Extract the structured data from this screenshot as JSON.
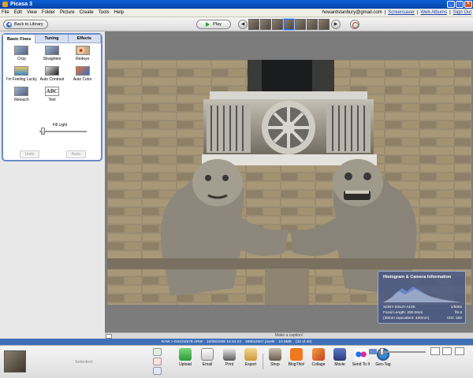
{
  "window": {
    "title": "Picasa 3"
  },
  "menu": [
    "File",
    "Edit",
    "View",
    "Folder",
    "Picture",
    "Create",
    "Tools",
    "Help"
  ],
  "account": {
    "email": "howardstanbury@gmail.com",
    "links": [
      "Screensaver",
      "Web Albums",
      "Sign Out"
    ]
  },
  "toolbar": {
    "back_label": "Back to Library",
    "play_label": "Play"
  },
  "edit_panel": {
    "tabs": [
      "Basic Fixes",
      "Tuning",
      "Effects"
    ],
    "tools": [
      {
        "label": "Crop",
        "icon": "crop-icon"
      },
      {
        "label": "Straighten",
        "icon": "straighten-icon"
      },
      {
        "label": "Redeye",
        "icon": "redeye-icon"
      },
      {
        "label": "I'm Feeling Lucky",
        "icon": "feeling-lucky-icon"
      },
      {
        "label": "Auto Contrast",
        "icon": "auto-contrast-icon"
      },
      {
        "label": "Auto Color",
        "icon": "auto-color-icon"
      },
      {
        "label": "Retouch",
        "icon": "retouch-icon"
      },
      {
        "label": "Text",
        "icon": "text-icon"
      }
    ],
    "fill_light_label": "Fill Light",
    "undo_label": "Undo",
    "redo_label": "Redo"
  },
  "histogram": {
    "title": "Histogram & Camera Information",
    "camera": "SONY DSLR-A100",
    "shutter": "1/500s",
    "focal_length": "Focal Length: 280.0mm",
    "aperture": "f/5.6",
    "equivalent": "(35mm equivalent: 420mm)",
    "iso": "ISO: 200"
  },
  "caption_placeholder": "Make a caption!",
  "status": {
    "filename": "RAW > DSC02578.ARW",
    "datetime": "10/06/2008 16:44:23",
    "dimensions": "3880x2607 pixels",
    "filesize": "10.5MB",
    "position": "(32 of 40)"
  },
  "tray": {
    "selection_label": "Selection",
    "actions": [
      "Upload",
      "Email",
      "Print",
      "Export",
      "Shop",
      "BlogThis!",
      "Collage",
      "Movie",
      "Send To It",
      "Geo-Tag"
    ]
  }
}
